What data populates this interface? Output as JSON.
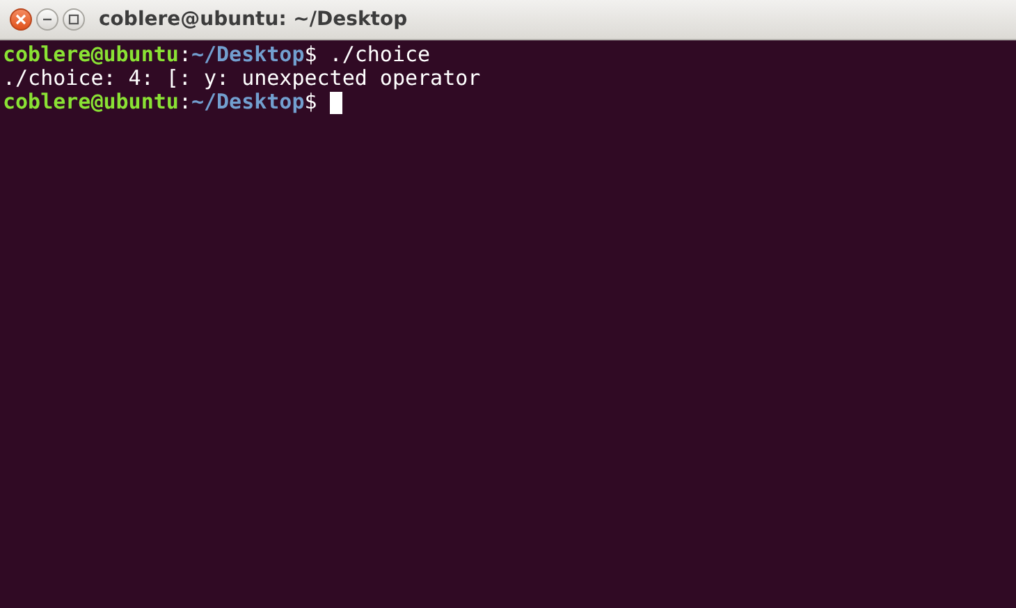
{
  "window": {
    "title": "coblere@ubuntu: ~/Desktop"
  },
  "terminal": {
    "lines": [
      {
        "segments": [
          {
            "kind": "user",
            "text": "coblere@ubuntu"
          },
          {
            "kind": "plain",
            "text": ":"
          },
          {
            "kind": "path",
            "text": "~/Desktop"
          },
          {
            "kind": "plain",
            "text": "$ ./choice"
          }
        ],
        "cursor": false
      },
      {
        "segments": [
          {
            "kind": "plain",
            "text": "./choice: 4: [: y: unexpected operator"
          }
        ],
        "cursor": false
      },
      {
        "segments": [
          {
            "kind": "user",
            "text": "coblere@ubuntu"
          },
          {
            "kind": "plain",
            "text": ":"
          },
          {
            "kind": "path",
            "text": "~/Desktop"
          },
          {
            "kind": "plain",
            "text": "$ "
          }
        ],
        "cursor": true
      }
    ]
  }
}
